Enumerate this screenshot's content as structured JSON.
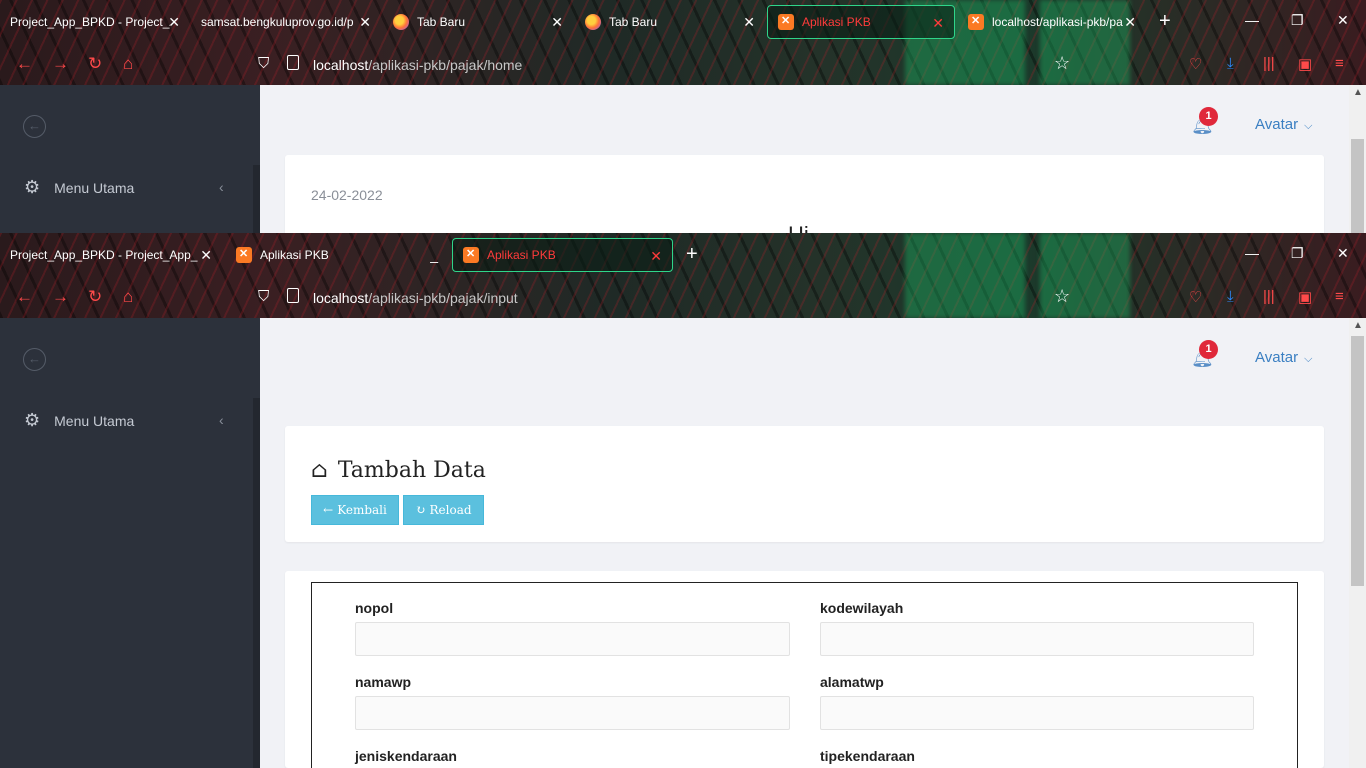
{
  "window1": {
    "tabs": [
      {
        "title": "Project_App_BPKD - Project_A",
        "icon": "none"
      },
      {
        "title": "samsat.bengkuluprov.go.id/p",
        "icon": "none"
      },
      {
        "title": "Tab Baru",
        "icon": "firefox-icon"
      },
      {
        "title": "Tab Baru",
        "icon": "firefox-icon"
      },
      {
        "title": "Aplikasi PKB",
        "icon": "xampp-icon",
        "active": true
      },
      {
        "title": "localhost/aplikasi-pkb/pa",
        "icon": "xampp-icon"
      }
    ],
    "url": {
      "host": "localhost",
      "path": "/aplikasi-pkb/pajak/home"
    },
    "sidebar": {
      "menu_label": "Menu Utama"
    },
    "header": {
      "notification_count": "1",
      "avatar_label": "Avatar"
    },
    "content": {
      "date": "24-02-2022",
      "cut_text": "Hi"
    }
  },
  "window2": {
    "tabs": [
      {
        "title": "Project_App_BPKD - Project_App_BP",
        "icon": "none"
      },
      {
        "title": "Aplikasi PKB",
        "icon": "xampp-icon"
      },
      {
        "title": "Aplikasi PKB",
        "icon": "xampp-icon",
        "active": true
      }
    ],
    "url": {
      "host": "localhost",
      "path": "/aplikasi-pkb/pajak/input"
    },
    "sidebar": {
      "menu_label": "Menu Utama"
    },
    "header": {
      "notification_count": "1",
      "avatar_label": "Avatar"
    },
    "page": {
      "title": "Tambah Data",
      "back_button": "Kembali",
      "reload_button": "Reload"
    },
    "form": {
      "fields": [
        {
          "label": "nopol",
          "value": ""
        },
        {
          "label": "kodewilayah",
          "value": ""
        },
        {
          "label": "namawp",
          "value": ""
        },
        {
          "label": "alamatwp",
          "value": ""
        },
        {
          "label": "jeniskendaraan",
          "value": ""
        },
        {
          "label": "tipekendaraan",
          "value": ""
        }
      ]
    }
  },
  "colors": {
    "active_tab_border": "#2fd58a",
    "accent_red": "#ff3b3b",
    "button_info": "#5bc0de",
    "sidebar_bg": "#2c313b",
    "badge": "#e0283a"
  }
}
